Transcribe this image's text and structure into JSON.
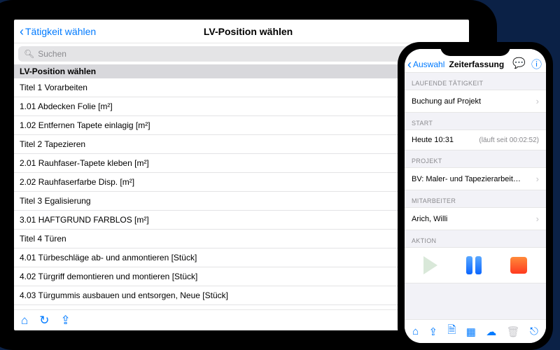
{
  "tablet": {
    "back_label": "Tätigkeit wählen",
    "title": "LV-Position wählen",
    "search_placeholder": "Suchen",
    "section_header": "LV-Position wählen",
    "rows": [
      "Titel 1 Vorarbeiten",
      "1.01 Abdecken Folie [m²]",
      "1.02 Entfernen Tapete einlagig [m²]",
      "Titel 2 Tapezieren",
      "2.01 Rauhfaser-Tapete kleben [m²]",
      "2.02 Rauhfaserfarbe Disp. [m²]",
      "Titel 3 Egalisierung",
      "3.01 HAFTGRUND FARBLOS [m²]",
      "Titel 4 Türen",
      "4.01 Türbeschläge ab- und anmontieren [Stück]",
      "4.02 Türgriff demontieren und montieren [Stück]",
      "4.03 Türgummis ausbauen und entsorgen, Neue [Stück]"
    ],
    "toolbar_icons": [
      "home-icon",
      "refresh-icon",
      "share-icon"
    ]
  },
  "phone": {
    "back_label": "Auswahl",
    "title": "Zeiterfassung",
    "sections": {
      "activity": {
        "label": "LAUFENDE TÄTIGKEIT",
        "value": "Buchung auf Projekt"
      },
      "start": {
        "label": "START",
        "time": "Heute 10:31",
        "elapsed": "(läuft seit 00:02:52)"
      },
      "project": {
        "label": "PROJEKT",
        "value": "BV: Maler- und Tapezierarbeiten Bürgerhaus..."
      },
      "employee": {
        "label": "MITARBEITER",
        "value": "Arich, Willi"
      },
      "action": {
        "label": "AKTION"
      }
    },
    "toolbar_icons": [
      "home-icon",
      "share-icon",
      "document-icon",
      "grid-icon",
      "cloud-icon",
      "trash-icon",
      "exit-icon"
    ]
  }
}
